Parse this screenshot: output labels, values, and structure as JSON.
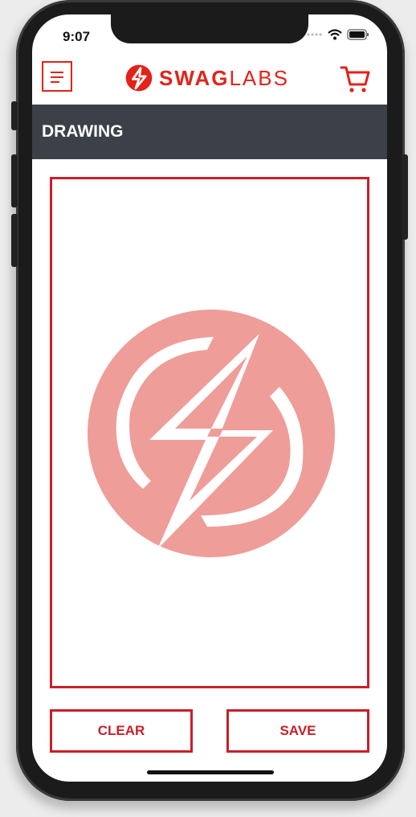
{
  "status_bar": {
    "time": "9:07"
  },
  "header": {
    "logo_bold": "SWAG",
    "logo_light": "LABS",
    "menu_icon": "hamburger-icon",
    "cart_icon": "cart-icon"
  },
  "page": {
    "title": "DRAWING"
  },
  "drawing": {
    "watermark_icon": "swag-labs-logo-icon"
  },
  "buttons": {
    "clear_label": "CLEAR",
    "save_label": "SAVE"
  },
  "colors": {
    "accent": "#e2231a",
    "title_bar": "#3c4149",
    "watermark": "#ee9d99"
  }
}
